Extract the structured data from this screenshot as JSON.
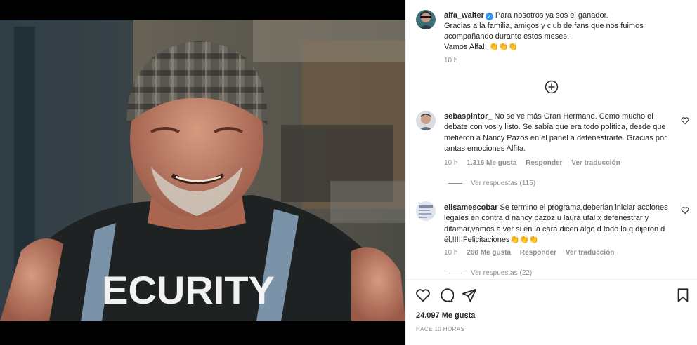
{
  "post": {
    "author": "alfa_walter",
    "caption_lines": [
      "Para nosotros ya sos el ganador.",
      "Gracias a la familia, amigos y club de fans que nos fuimos",
      "acompañando durante estos meses.",
      "Vamos Alfa!! 👏👏👏"
    ],
    "time": "10 h",
    "image_shirt_text": "ECURITY",
    "likes": "24.097 Me gusta",
    "posted_ago": "HACE 10 HORAS"
  },
  "comments": [
    {
      "username": "sebaspintor_",
      "text": "No se ve más Gran Hermano. Como mucho el debate con vos y listo. Se sabía que era todo política, desde que metieron a Nancy Pazos en el panel a defenestrarte. Gracias por tantas emociones Alfita.",
      "time": "10 h",
      "likes": "1.316 Me gusta",
      "reply_label": "Responder",
      "translate_label": "Ver traducción",
      "view_replies": "Ver respuestas (115)"
    },
    {
      "username": "elisamescobar",
      "text": "Se termino el programa,deberian iniciar acciones legales en contra d nancy pazoz u laura ufal x defenestrar y difamar,vamos a ver si en la cara dicen algo d todo lo q dijeron d él,!!!!!Felicitaciones👏👏👏",
      "time": "10 h",
      "likes": "268 Me gusta",
      "reply_label": "Responder",
      "translate_label": "Ver traducción",
      "view_replies": "Ver respuestas (22)"
    }
  ],
  "icons": {
    "verified": "verified-badge-icon",
    "load_more": "plus-circle-icon",
    "like": "heart-icon",
    "comment": "comment-bubble-icon",
    "share": "paper-plane-icon",
    "save": "bookmark-icon"
  },
  "colors": {
    "verified_blue": "#3897f0",
    "muted": "#8e8e8e",
    "text": "#262626"
  }
}
